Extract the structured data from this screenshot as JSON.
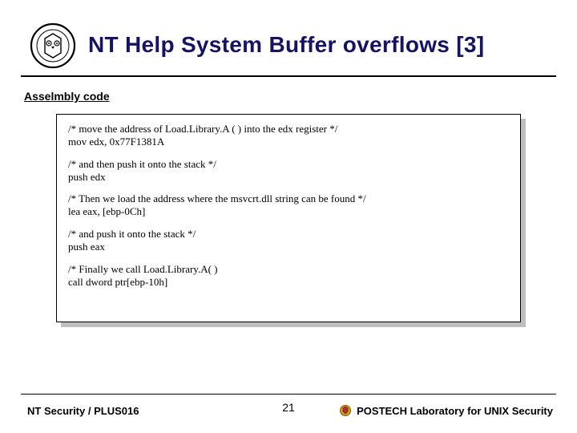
{
  "title": "NT Help System Buffer overflows [3]",
  "section_header": "Asselmbly code",
  "code": {
    "g1": {
      "c": "/* move the address of Load.Library.A ( ) into the edx register */",
      "i": "mov edx, 0x77F1381A"
    },
    "g2": {
      "c": "/* and then push it onto the stack */",
      "i": "push edx"
    },
    "g3": {
      "c": "/* Then we load the address where the msvcrt.dll string can be found */",
      "i": "lea eax, [ebp-0Ch]"
    },
    "g4": {
      "c": "/* and push it onto the stack */",
      "i": "push eax"
    },
    "g5": {
      "c": "/* Finally we call Load.Library.A( )",
      "i": "call dword ptr[ebp-10h]"
    }
  },
  "footer": {
    "left": "NT Security / PLUS016",
    "page": "21",
    "right": "POSTECH Laboratory for UNIX Security"
  }
}
